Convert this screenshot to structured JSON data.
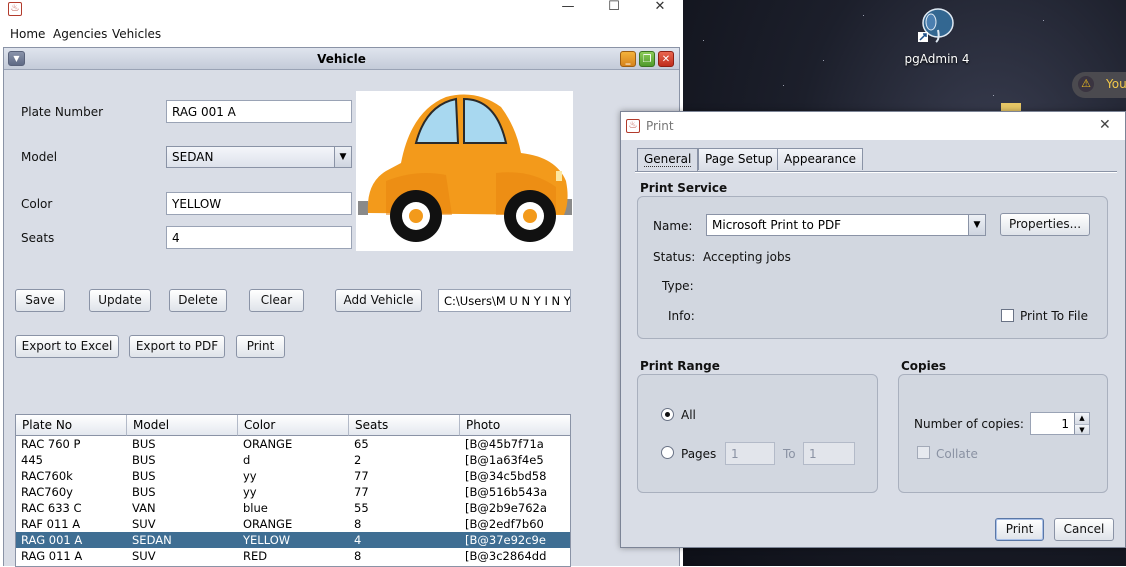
{
  "desktop": {
    "icon_label": "pgAdmin 4",
    "notif_text": "You"
  },
  "app": {
    "menu": [
      "Home",
      "Agencies",
      "Vehicles"
    ]
  },
  "vehicle_form": {
    "title": "Vehicle",
    "labels": {
      "plate": "Plate Number",
      "model": "Model",
      "color": "Color",
      "seats": "Seats"
    },
    "values": {
      "plate": "RAG 001 A",
      "model": "SEDAN",
      "color": "YELLOW",
      "seats": "4",
      "photo_path": "C:\\Users\\M U N Y I N Y"
    },
    "buttons": {
      "save": "Save",
      "update": "Update",
      "delete": "Delete",
      "clear": "Clear",
      "add_vehicle": "Add Vehicle",
      "export_excel": "Export to Excel",
      "export_pdf": "Export to PDF",
      "print": "Print"
    },
    "table": {
      "columns": [
        "Plate No",
        "Model",
        "Color",
        "Seats",
        "Photo"
      ],
      "rows": [
        [
          "RAC 760 P",
          "BUS",
          "ORANGE",
          "65",
          "[B@45b7f71a"
        ],
        [
          "445",
          "BUS",
          "d",
          "2",
          "[B@1a63f4e5"
        ],
        [
          "RAC760k",
          "BUS",
          "yy",
          "77",
          "[B@34c5bd58"
        ],
        [
          "RAC760y",
          "BUS",
          "yy",
          "77",
          "[B@516b543a"
        ],
        [
          "RAC 633 C",
          "VAN",
          "blue",
          "55",
          "[B@2b9e762a"
        ],
        [
          "RAF 011 A",
          "SUV",
          "ORANGE",
          "8",
          "[B@2edf7b60"
        ],
        [
          "RAG 001 A",
          "SEDAN",
          "YELLOW",
          "4",
          "[B@37e92c9e"
        ],
        [
          "RAG 011 A",
          "SUV",
          "RED",
          "8",
          "[B@3c2864dd"
        ]
      ],
      "selected_row": 6
    }
  },
  "print_dialog": {
    "title": "Print",
    "tabs": [
      "General",
      "Page Setup",
      "Appearance"
    ],
    "service": {
      "title": "Print Service",
      "name_label": "Name:",
      "name_value": "Microsoft Print to PDF",
      "properties": "Properties...",
      "status_label": "Status:",
      "status_value": "Accepting jobs",
      "type_label": "Type:",
      "info_label": "Info:",
      "print_to_file": "Print To File"
    },
    "range": {
      "title": "Print Range",
      "all": "All",
      "pages": "Pages",
      "from": "1",
      "to_label": "To",
      "to": "1"
    },
    "copies": {
      "title": "Copies",
      "number_label": "Number of copies:",
      "number_value": "1",
      "collate": "Collate"
    },
    "buttons": {
      "print": "Print",
      "cancel": "Cancel"
    }
  }
}
